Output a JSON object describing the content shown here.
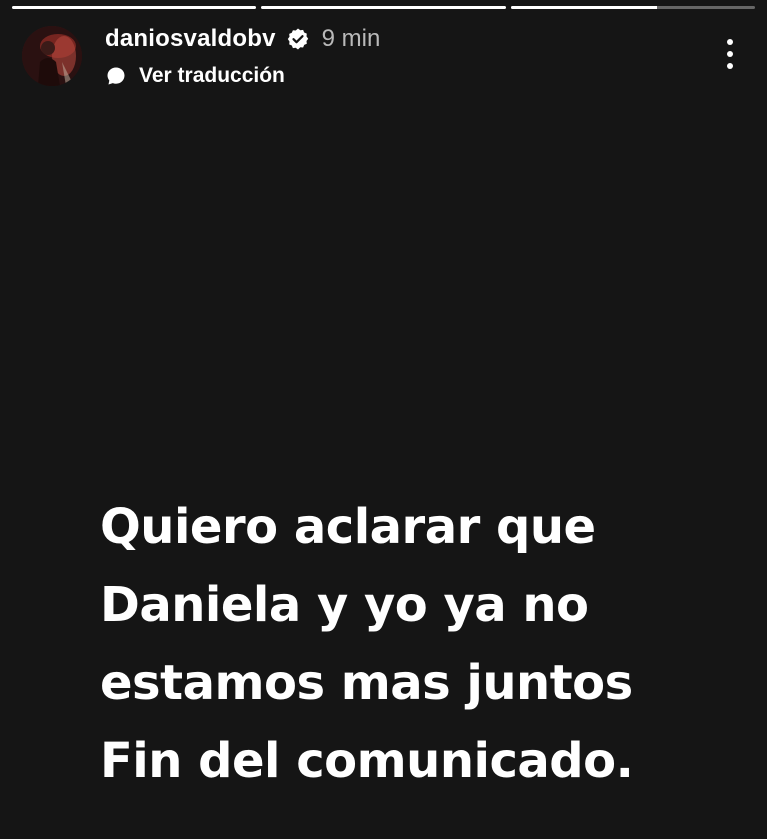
{
  "story": {
    "progress": [
      1,
      1,
      0.6
    ],
    "user": {
      "username": "daniosvaldobv",
      "verified": true,
      "time": "9 min",
      "translate_label": "Ver traducción"
    },
    "text_lines": [
      "Quiero aclarar que",
      "Daniela y yo ya no",
      "estamos mas juntos",
      "Fin del comunicado."
    ]
  },
  "icons": {
    "verified": "verified-badge-icon",
    "translate": "speech-bubble-icon",
    "more": "more-vertical-icon"
  },
  "colors": {
    "background": "#151515",
    "text": "#ffffff",
    "muted": "#b9b9b9"
  }
}
